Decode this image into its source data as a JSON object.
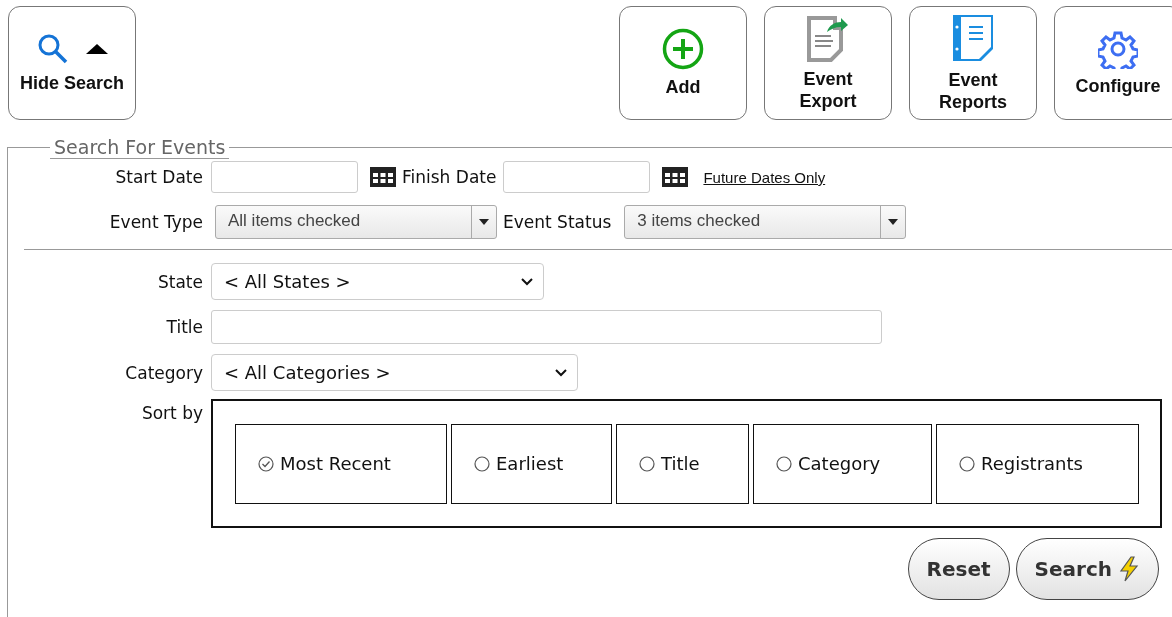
{
  "toolbar": {
    "left": [
      {
        "kind": "hide-search",
        "label": "Hide Search"
      }
    ],
    "right": [
      {
        "kind": "add",
        "label": "Add"
      },
      {
        "kind": "export",
        "label": "Event Export"
      },
      {
        "kind": "reports",
        "label": "Event Reports"
      },
      {
        "kind": "configure",
        "label": "Configure"
      }
    ]
  },
  "search": {
    "legend": "Search For Events",
    "start_date": {
      "label": "Start Date"
    },
    "finish_date": {
      "label": "Finish Date"
    },
    "future_link": "Future Dates Only",
    "event_type": {
      "label": "Event Type",
      "value": "All items checked"
    },
    "event_status": {
      "label": "Event Status",
      "value": "3 items checked"
    },
    "state": {
      "label": "State",
      "value": "< All States >"
    },
    "title": {
      "label": "Title"
    },
    "category": {
      "label": "Category",
      "value": "< All Categories >"
    },
    "sort": {
      "label": "Sort by",
      "options": [
        {
          "label": "Most Recent",
          "selected": true
        },
        {
          "label": "Earliest",
          "selected": false
        },
        {
          "label": "Title",
          "selected": false
        },
        {
          "label": "Category",
          "selected": false
        },
        {
          "label": "Registrants",
          "selected": false
        }
      ]
    },
    "buttons": [
      {
        "kind": "reset",
        "label": "Reset"
      },
      {
        "kind": "search",
        "label": "Search"
      }
    ]
  }
}
